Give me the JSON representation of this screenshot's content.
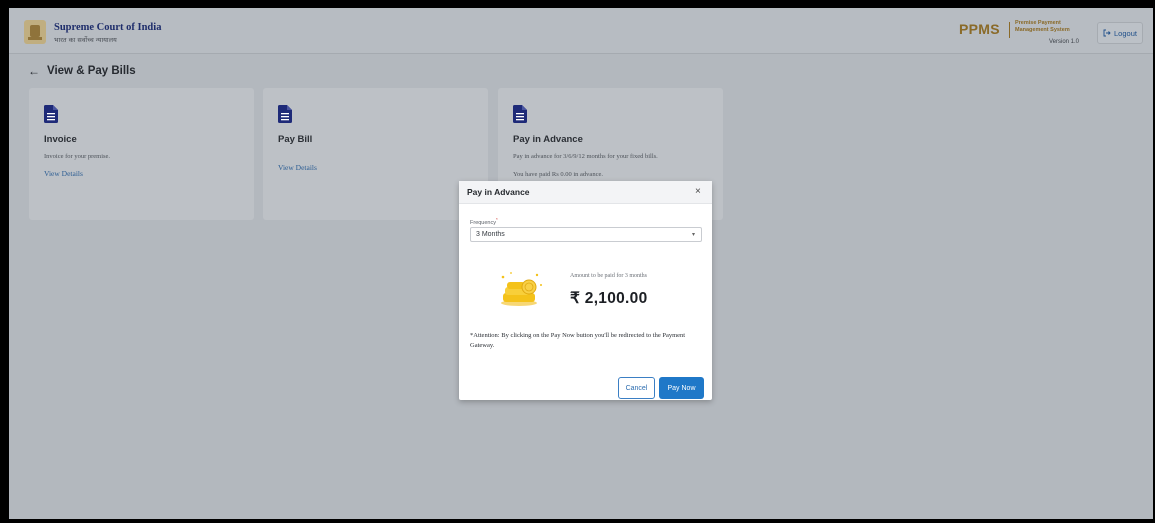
{
  "header": {
    "org_name": "Supreme Court of India",
    "org_subtitle": "भारत का सर्वोच्च न्यायालय",
    "app_logo": "PPMS",
    "app_full_name": "Premise Payment Management System",
    "version": "Version 1.0",
    "logout_label": "Logout",
    "logout_icon": "logout-icon"
  },
  "page": {
    "back_icon": "←",
    "title": "View & Pay Bills"
  },
  "cards": [
    {
      "title": "Invoice",
      "description": "Invoice for your premise.",
      "link": "View Details"
    },
    {
      "title": "Pay Bill",
      "link": "View Details"
    },
    {
      "title": "Pay in Advance",
      "description": "Pay in advance for 3/6/9/12 months for your fixed bills.",
      "description2": "You have paid Rs 0.00 in advance."
    }
  ],
  "modal": {
    "title": "Pay in Advance",
    "close_glyph": "×",
    "frequency_label": "Frequency",
    "frequency_required": "*",
    "frequency_value": "3 Months",
    "caret_glyph": "▾",
    "amount_caption": "Amount to be paid for 3 months",
    "amount_value": "₹ 2,100.00",
    "attention_text": "*Attention: By clicking on the Pay Now button you'll be redirected to the Payment Gateway.",
    "cancel_label": "Cancel",
    "paynow_label": "Pay Now"
  },
  "colors": {
    "primary": "#1f78c8",
    "doc_icon": "#1e2a78",
    "overlay_bg": "#b3b8be",
    "coins": "#f4c21a"
  }
}
